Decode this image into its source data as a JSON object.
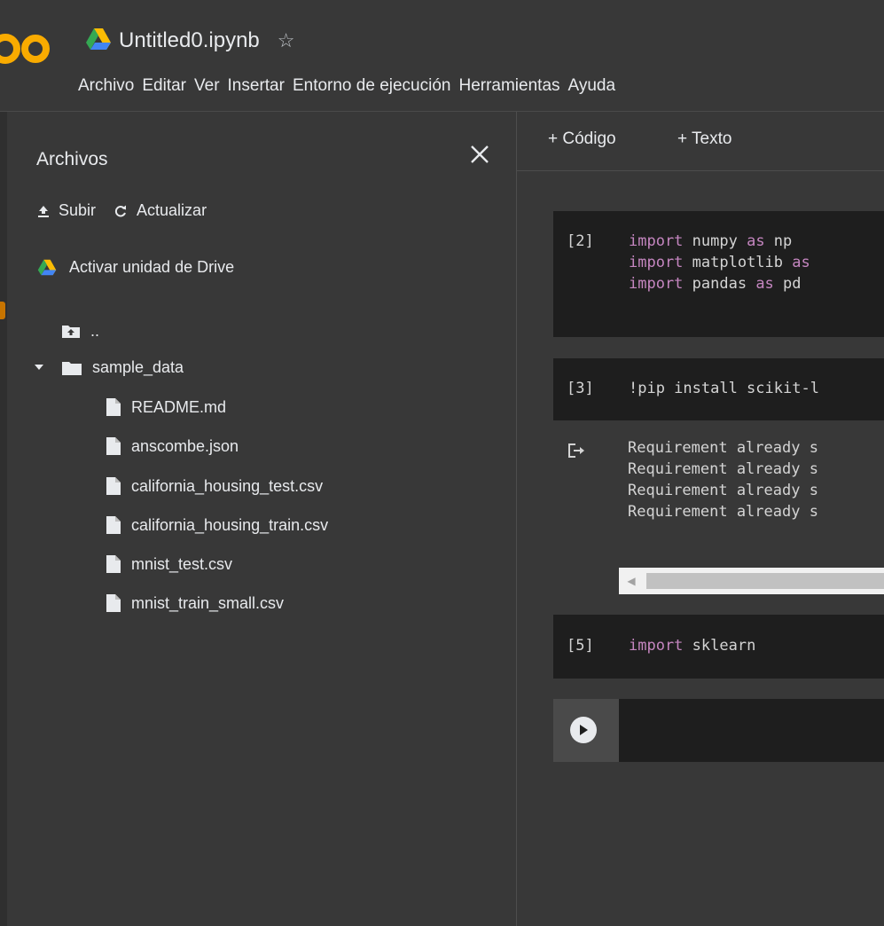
{
  "header": {
    "notebook_title": "Untitled0.ipynb",
    "menu": [
      "Archivo",
      "Editar",
      "Ver",
      "Insertar",
      "Entorno de ejecución",
      "Herramientas",
      "Ayuda"
    ]
  },
  "sidebar": {
    "title": "Archivos",
    "upload_label": "Subir",
    "refresh_label": "Actualizar",
    "mount_drive_label": "Activar unidad de Drive",
    "parent_dir_label": "..",
    "folder_name": "sample_data",
    "files": [
      "README.md",
      "anscombe.json",
      "california_housing_test.csv",
      "california_housing_train.csv",
      "mnist_test.csv",
      "mnist_train_small.csv"
    ]
  },
  "toolbar": {
    "add_code_label": "+ Código",
    "add_text_label": "+ Texto"
  },
  "cells": [
    {
      "exec_count": "[2]",
      "lines": [
        {
          "kw1": "import",
          "mid": " numpy ",
          "kw2": "as",
          "tail": " np"
        },
        {
          "kw1": "import",
          "mid": " matplotlib ",
          "kw2": "as",
          "tail": ""
        },
        {
          "kw1": "import",
          "mid": " pandas ",
          "kw2": "as",
          "tail": " pd"
        }
      ]
    },
    {
      "exec_count": "[3]",
      "code": "!pip install scikit-l",
      "output": [
        "Requirement already s",
        "Requirement already s",
        "Requirement already s",
        "Requirement already s"
      ]
    },
    {
      "exec_count": "[5]",
      "kw": "import",
      "rest": " sklearn"
    }
  ],
  "icons": {
    "logo": "colab-logo-icon",
    "drive": "google-drive-icon",
    "star": "star-outline-icon",
    "close": "close-icon",
    "upload": "upload-icon",
    "refresh": "refresh-icon",
    "folder_up": "folder-up-icon",
    "folder": "folder-icon",
    "file": "file-icon",
    "output": "output-redirect-icon",
    "run": "play-circle-icon"
  },
  "colors": {
    "background": "#383838",
    "cell_background": "#1e1e1e",
    "keyword": "#c586c0",
    "code_text": "#d4d4d4",
    "logo_orange": "#f9ab00"
  }
}
